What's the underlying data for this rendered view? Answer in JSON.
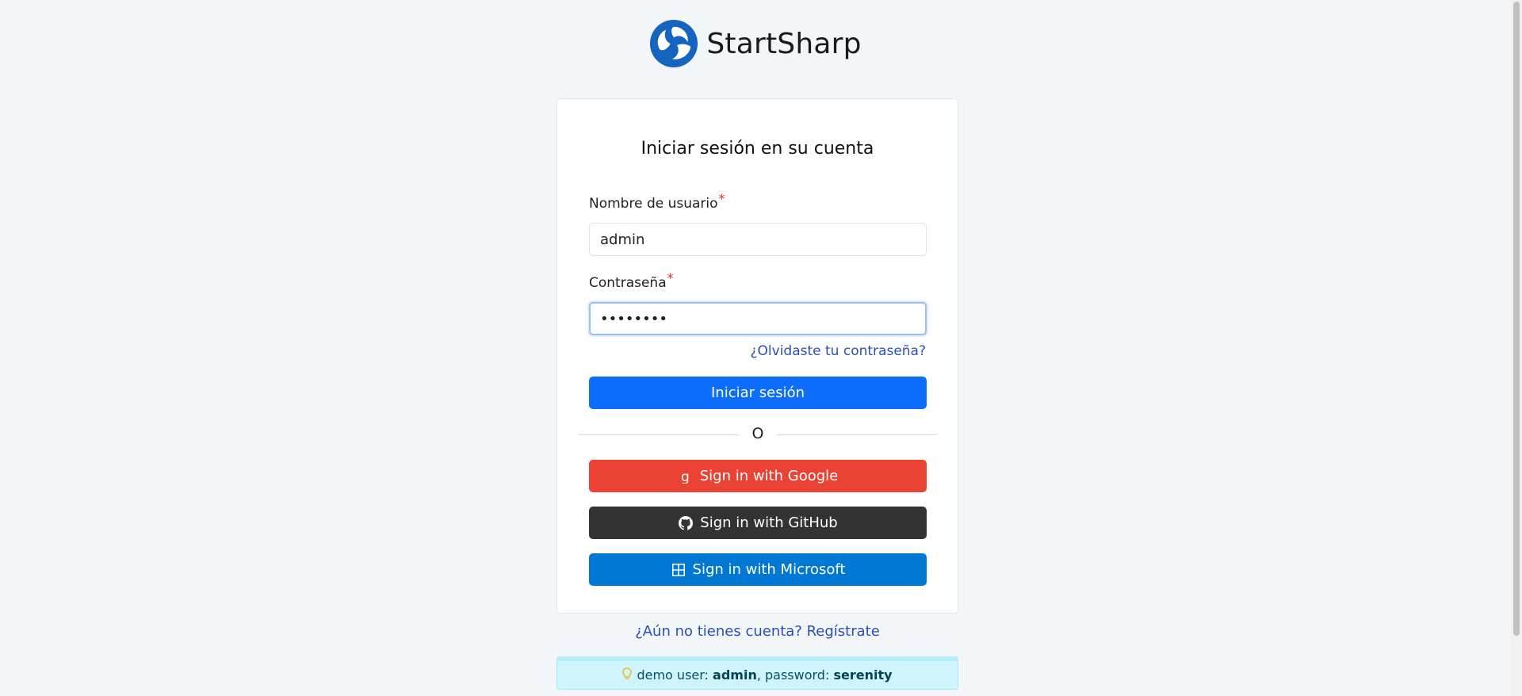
{
  "brand": {
    "name": "StartSharp",
    "logo_icon": "startsharp-swirl-logo",
    "color": "#1565c0"
  },
  "login": {
    "title": "Iniciar sesión en su cuenta",
    "username_label": "Nombre de usuario",
    "username_value": "admin",
    "password_label": "Contraseña",
    "password_value": "••••••••",
    "required_marker": "*",
    "forgot_link": "¿Olvidaste tu contraseña?",
    "submit_label": "Iniciar sesión",
    "divider_text": "O"
  },
  "oauth": {
    "google_label": "Sign in with Google",
    "github_label": "Sign in with GitHub",
    "microsoft_label": "Sign in with Microsoft",
    "google_color": "#ea4335",
    "github_color": "#333333",
    "microsoft_color": "#0078d4"
  },
  "register_link": "¿Aún no tienes cuenta? Regístrate",
  "demo": {
    "prefix": "demo user:",
    "user": "admin",
    "separator": ", password:",
    "password": "serenity",
    "icon": "lightbulb-icon"
  },
  "colors": {
    "primary": "#0d6efd",
    "link": "#2a4fb8",
    "required": "#e0302b",
    "info_bg": "#cff4fc"
  }
}
